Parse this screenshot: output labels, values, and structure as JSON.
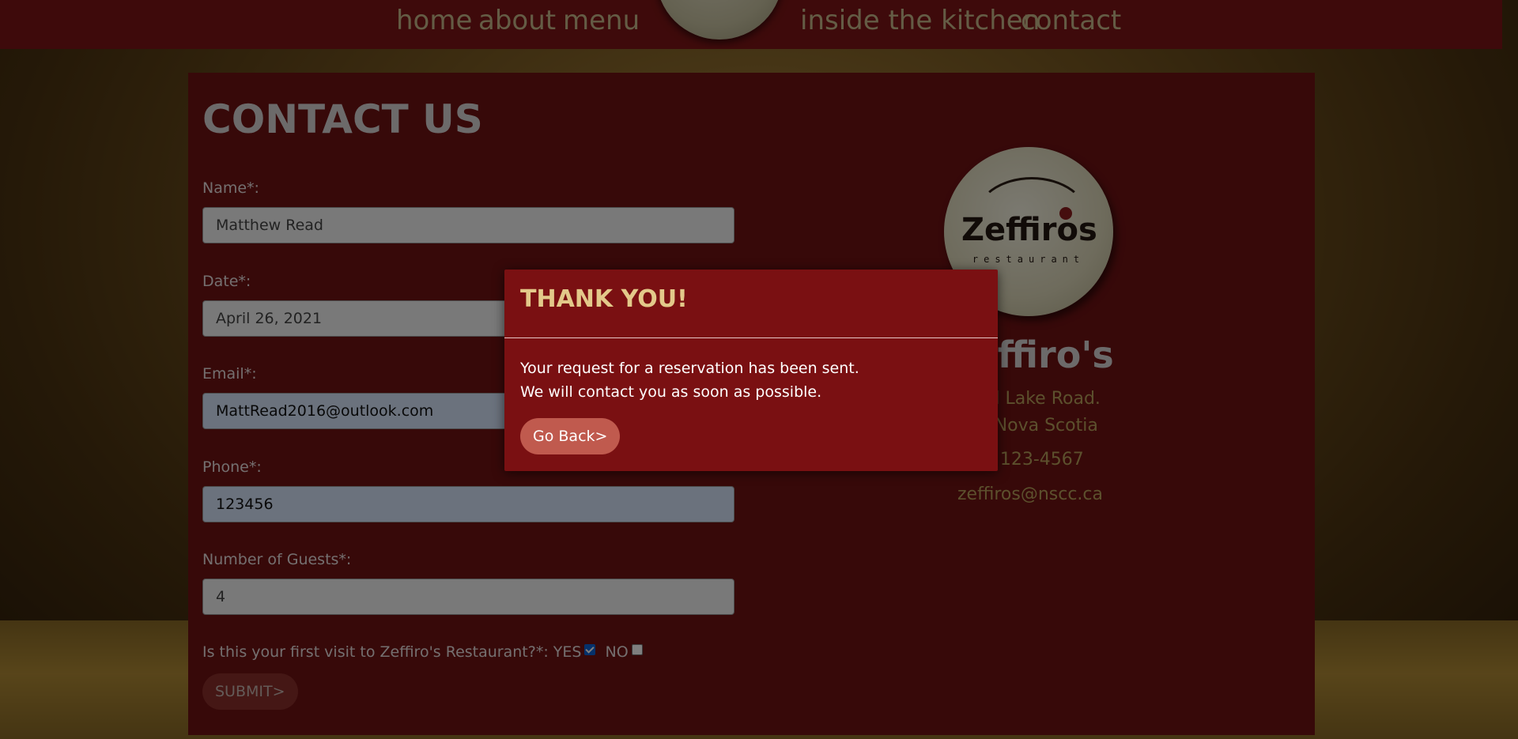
{
  "nav": {
    "links": [
      "home",
      "about",
      "menu",
      "inside the kitchen",
      "contact"
    ]
  },
  "page": {
    "title": "CONTACT US"
  },
  "form": {
    "name_label": "Name*:",
    "name_value": "Matthew Read",
    "date_label": "Date*:",
    "date_value": "April 26, 2021",
    "email_label": "Email*:",
    "email_value": "MattRead2016@outlook.com",
    "phone_label": "Phone*:",
    "phone_value": "123456",
    "guests_label": "Number of Guests*:",
    "guests_value": "4",
    "visit_question": "Is this your first visit to Zeffiro's Restaurant?*:",
    "yes_label": "YES",
    "yes_checked": true,
    "no_label": "NO",
    "no_checked": false,
    "submit_label": "SUBMIT>"
  },
  "sidebar": {
    "logo_word": "Zeffiros",
    "logo_sub": "restaurant",
    "name": "Zeffiro's",
    "address_line1": "rand Lake Road.",
    "address_line2": "ey, Nova Scotia",
    "phone": "2) 123-4567",
    "email": "zeffiros@nscc.ca"
  },
  "modal": {
    "title": "THANK YOU!",
    "line1": "Your request for a reservation has been sent.",
    "line2": "We will contact you as soon as possible.",
    "button_label": "Go Back>"
  },
  "colors": {
    "accent": "#7a1012",
    "title_gold": "#e3c98a",
    "link_gold": "#b8a15a"
  }
}
